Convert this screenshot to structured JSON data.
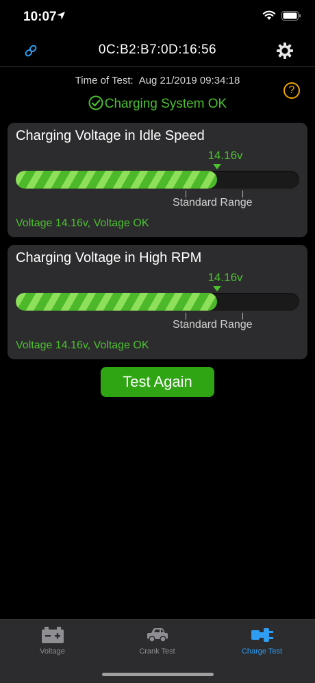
{
  "status_bar": {
    "time": "10:07"
  },
  "nav": {
    "title": "0C:B2:B7:0D:16:56"
  },
  "test": {
    "time_label": "Time of Test:",
    "time_value": "Aug 21/2019 09:34:18",
    "result": "Charging System OK"
  },
  "cards": [
    {
      "title": "Charging Voltage in Idle Speed",
      "reading": "14.16v",
      "level_fraction": 0.71,
      "range_label": "Standard Range",
      "message": "Voltage 14.16v, Voltage OK"
    },
    {
      "title": "Charging Voltage in High RPM",
      "reading": "14.16v",
      "level_fraction": 0.71,
      "range_label": "Standard Range",
      "message": "Voltage 14.16v, Voltage OK"
    }
  ],
  "actions": {
    "test_again": "Test Again"
  },
  "tabs": [
    {
      "label": "Voltage",
      "icon": "battery-icon"
    },
    {
      "label": "Crank Test",
      "icon": "car-icon"
    },
    {
      "label": "Charge Test",
      "icon": "plug-icon",
      "active": true
    }
  ],
  "colors": {
    "accent_green": "#4cc12e",
    "button_green": "#2fa514",
    "help_orange": "#f0a500",
    "active_tab_blue": "#2f9df2",
    "link_blue": "#2f9df2"
  }
}
